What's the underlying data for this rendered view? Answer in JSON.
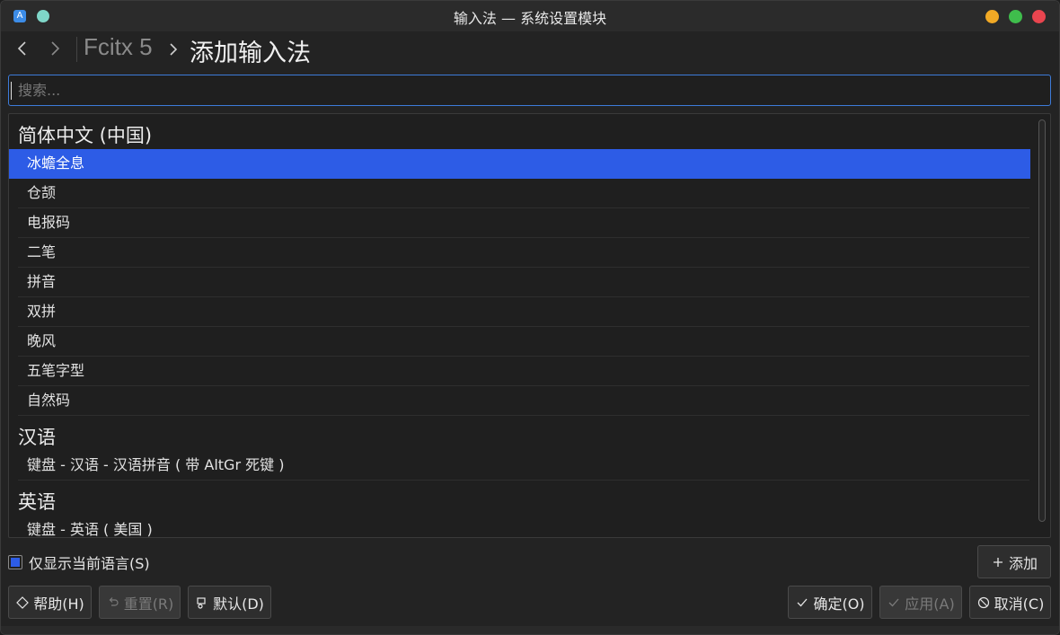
{
  "window": {
    "title": "输入法 — 系统设置模块",
    "app_icon_letter": "A"
  },
  "navbar": {
    "breadcrumb_root": "Fcitx 5",
    "breadcrumb_current": "添加输入法"
  },
  "search": {
    "placeholder": "搜索...",
    "value": ""
  },
  "list": {
    "groups": [
      {
        "header": "简体中文 (中国)",
        "items": [
          "冰蟾全息",
          "仓颉",
          "电报码",
          "二笔",
          "拼音",
          "双拼",
          "晚风",
          "五笔字型",
          "自然码"
        ]
      },
      {
        "header": "汉语",
        "items": [
          "键盘 - 汉语 - 汉语拼音 ( 带 AltGr 死键 )"
        ]
      },
      {
        "header": "英语",
        "items": [
          "键盘 - 英语 ( 美国 )"
        ]
      }
    ],
    "selected_item": "冰蟾全息"
  },
  "options": {
    "only_current_language_label": "仅显示当前语言(S)",
    "only_current_language_checked": true
  },
  "buttons": {
    "add": "添加",
    "help": "帮助(H)",
    "reset": "重置(R)",
    "default": "默认(D)",
    "ok": "确定(O)",
    "apply": "应用(A)",
    "cancel": "取消(C)"
  },
  "colors": {
    "accent": "#2d5ce6",
    "focus_border": "#3d7bd9",
    "close": "#e9454f",
    "minimize": "#f1a925",
    "maximize": "#3fbd4c"
  }
}
